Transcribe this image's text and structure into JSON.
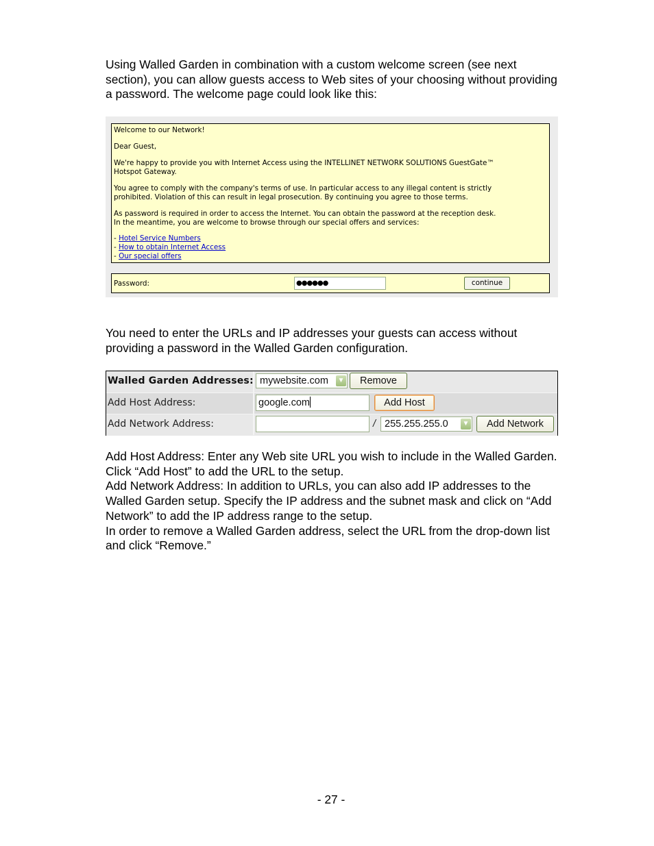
{
  "paragraphs": {
    "intro": "Using Walled Garden in combination with a custom welcome screen (see next\nsection), you can allow guests access to Web sites of your choosing without providing\na password. The welcome page could look like this:",
    "config_intro": "You need to enter the URLs and IP addresses your guests can access without\nproviding a password in the Walled Garden configuration.",
    "instructions": "Add Host Address: Enter any Web site URL you wish to include in the Walled Garden.\nClick “Add Host” to add the URL to the setup.\nAdd Network Address: In addition to URLs, you can also add IP addresses to the\nWalled Garden setup. Specify the IP address and the subnet mask and click on “Add\nNetwork” to add the IP address range to the setup.\nIn order to remove a Walled Garden address, select the URL from the drop-down list\nand click “Remove.”"
  },
  "welcome_screen": {
    "heading": "Welcome to our Network!",
    "greeting": "Dear Guest,",
    "body1": "We're happy to provide you with Internet Access using the INTELLINET NETWORK SOLUTIONS GuestGate™\nHotspot Gateway.",
    "body2": "You agree to comply with the company's terms of use. In particular access to any illegal content is strictly\nprohibited. Violation of this can result in legal prosecution. By continuing you agree to those terms.",
    "body3": "As password is required in order to access the Internet. You can obtain the password at the reception desk.\nIn the meantime, you are welcome to browse through our special offers and services:",
    "link_prefix": "- ",
    "links": [
      "Hotel Service Numbers",
      "How to obtain Internet Access",
      "Our special offers"
    ],
    "password_label": "Password:",
    "password_value": "●●●●●●",
    "continue_label": "continue"
  },
  "walled_garden": {
    "addresses_label": "Walled Garden Addresses:",
    "addresses_selected": "mywebsite.com",
    "remove_label": "Remove",
    "host_label": "Add Host Address:",
    "host_value": "google.com",
    "add_host_label": "Add Host",
    "network_label": "Add Network Address:",
    "network_value": "",
    "separator": "/",
    "mask_selected": "255.255.255.0",
    "add_network_label": "Add Network",
    "dropdown_icon": "▼"
  },
  "page_number": "- 27 -"
}
